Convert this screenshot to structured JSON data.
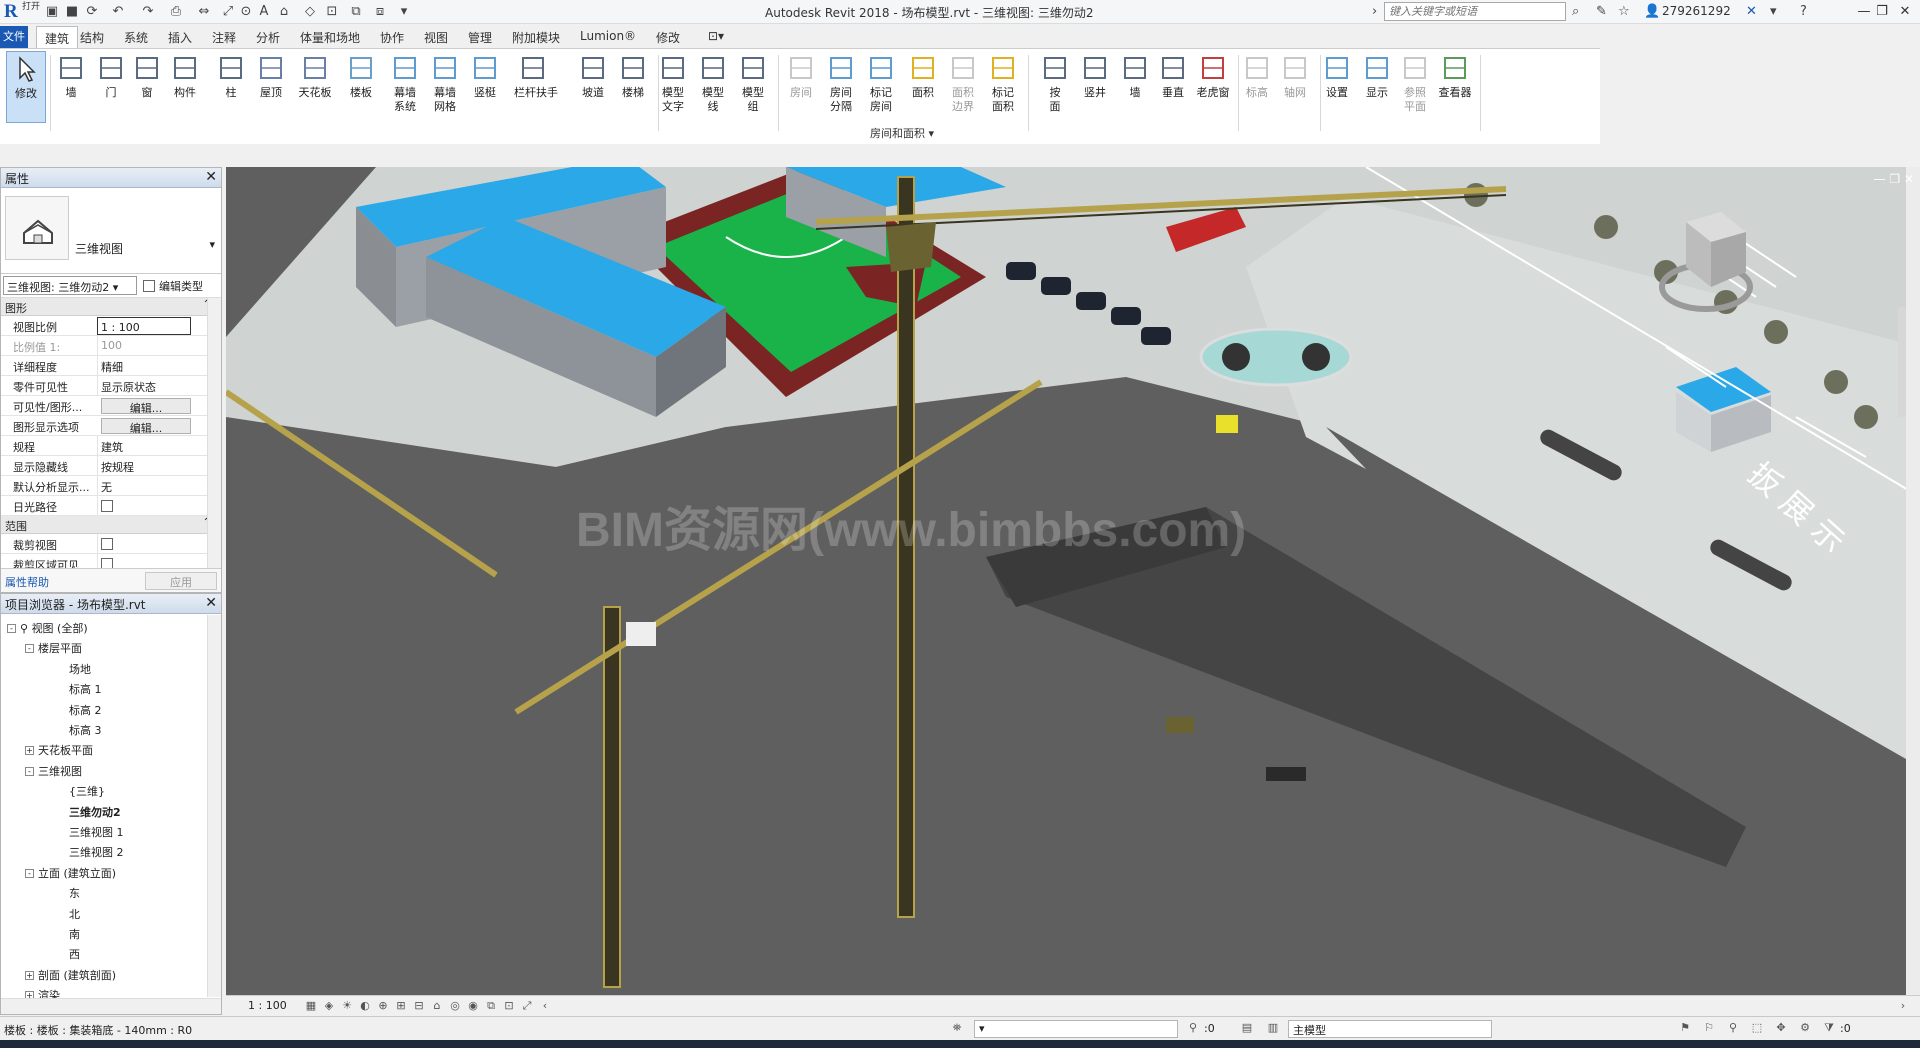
{
  "titlebar": {
    "app_sub": "打开",
    "title": "Autodesk Revit 2018 -    场布模型.rvt - 三维视图: 三维勿动2",
    "search_placeholder": "键入关键字或短语",
    "user": "279261292"
  },
  "ribbon_tabs": [
    "文件",
    "建筑",
    "结构",
    "系统",
    "插入",
    "注释",
    "分析",
    "体量和场地",
    "协作",
    "视图",
    "管理",
    "附加模块",
    "Lumion®",
    "修改"
  ],
  "ribbon": {
    "buttons": [
      {
        "label": "修改",
        "icon": "arrow-cursor-icon"
      },
      {
        "label": "墙",
        "icon": "wall-icon"
      },
      {
        "label": "门",
        "icon": "door-icon"
      },
      {
        "label": "窗",
        "icon": "window-icon"
      },
      {
        "label": "构件",
        "icon": "component-icon"
      },
      {
        "label": "柱",
        "icon": "column-icon"
      },
      {
        "label": "屋顶",
        "icon": "roof-icon"
      },
      {
        "label": "天花板",
        "icon": "ceiling-icon"
      },
      {
        "label": "楼板",
        "icon": "floor-icon"
      },
      {
        "label": "幕墙\n系统",
        "icon": "curtain-system-icon"
      },
      {
        "label": "幕墙\n网格",
        "icon": "curtain-grid-icon"
      },
      {
        "label": "竖梃",
        "icon": "mullion-icon"
      },
      {
        "label": "栏杆扶手",
        "icon": "railing-icon"
      },
      {
        "label": "坡道",
        "icon": "ramp-icon"
      },
      {
        "label": "楼梯",
        "icon": "stair-icon"
      },
      {
        "label": "模型\n文字",
        "icon": "model-text-icon"
      },
      {
        "label": "模型\n线",
        "icon": "model-line-icon"
      },
      {
        "label": "模型\n组",
        "icon": "model-group-icon"
      },
      {
        "label": "房间",
        "icon": "room-icon"
      },
      {
        "label": "房间\n分隔",
        "icon": "room-separator-icon"
      },
      {
        "label": "标记\n房间",
        "icon": "tag-room-icon"
      },
      {
        "label": "面积",
        "icon": "area-icon"
      },
      {
        "label": "面积\n边界",
        "icon": "area-boundary-icon"
      },
      {
        "label": "标记\n面积",
        "icon": "tag-area-icon"
      },
      {
        "label": "按\n面",
        "icon": "by-face-icon"
      },
      {
        "label": "竖井",
        "icon": "shaft-icon"
      },
      {
        "label": "墙",
        "icon": "wall-opening-icon"
      },
      {
        "label": "垂直",
        "icon": "vertical-opening-icon"
      },
      {
        "label": "老虎窗",
        "icon": "dormer-icon"
      },
      {
        "label": "标高",
        "icon": "level-icon"
      },
      {
        "label": "轴网",
        "icon": "grid-icon"
      },
      {
        "label": "设置",
        "icon": "workplane-set-icon"
      },
      {
        "label": "显示",
        "icon": "workplane-show-icon"
      },
      {
        "label": "参照\n平面",
        "icon": "ref-plane-icon"
      },
      {
        "label": "查看器",
        "icon": "viewer-icon"
      }
    ],
    "panel_label": "房间和面积 ▾"
  },
  "properties": {
    "title": "属性",
    "type_name": "三维视图",
    "view_selector": "三维视图: 三维勿动2",
    "edit_type": "编辑类型",
    "groups": [
      {
        "name": "图形",
        "rows": [
          {
            "k": "视图比例",
            "v": "1 : 100"
          },
          {
            "k": "比例值 1:",
            "v": "100"
          },
          {
            "k": "详细程度",
            "v": "精细"
          },
          {
            "k": "零件可见性",
            "v": "显示原状态"
          },
          {
            "k": "可见性/图形...",
            "v": "编辑..."
          },
          {
            "k": "图形显示选项",
            "v": "编辑..."
          },
          {
            "k": "规程",
            "v": "建筑"
          },
          {
            "k": "显示隐藏线",
            "v": "按规程"
          },
          {
            "k": "默认分析显示...",
            "v": "无"
          },
          {
            "k": "日光路径",
            "v": ""
          }
        ]
      },
      {
        "name": "范围",
        "rows": [
          {
            "k": "裁剪视图",
            "v": ""
          },
          {
            "k": "裁剪区域可见",
            "v": ""
          }
        ]
      }
    ],
    "help_link": "属性帮助",
    "apply": "应用"
  },
  "browser": {
    "title": "项目浏览器 - 场布模型.rvt",
    "items": [
      {
        "label": "视图 (全部)",
        "level": 0,
        "exp": "-"
      },
      {
        "label": "楼层平面",
        "level": 1,
        "exp": "-"
      },
      {
        "label": "场地",
        "level": 2
      },
      {
        "label": "标高 1",
        "level": 2
      },
      {
        "label": "标高 2",
        "level": 2
      },
      {
        "label": "标高 3",
        "level": 2
      },
      {
        "label": "天花板平面",
        "level": 1,
        "exp": "+"
      },
      {
        "label": "三维视图",
        "level": 1,
        "exp": "-"
      },
      {
        "label": "{三维}",
        "level": 2
      },
      {
        "label": "三维勿动2",
        "level": 2,
        "bold": true
      },
      {
        "label": "三维视图 1",
        "level": 2
      },
      {
        "label": "三维视图 2",
        "level": 2
      },
      {
        "label": "立面 (建筑立面)",
        "level": 1,
        "exp": "-"
      },
      {
        "label": "东",
        "level": 2
      },
      {
        "label": "北",
        "level": 2
      },
      {
        "label": "南",
        "level": 2
      },
      {
        "label": "西",
        "level": 2
      },
      {
        "label": "剖面 (建筑剖面)",
        "level": 1,
        "exp": "+"
      },
      {
        "label": "渲染",
        "level": 1,
        "exp": "+"
      }
    ]
  },
  "canvas": {
    "watermark": "BIM资源网(www.bimbbs.com)",
    "sign_text": "扳  展  示"
  },
  "viewbar": {
    "scale": "1 : 100"
  },
  "statusbar": {
    "text": "楼板 : 楼板 : 集装箱底 - 140mm : R0",
    "zero1": ":0",
    "model": "主模型",
    "zero2": ":0"
  },
  "colors": {
    "revit_blue": "#1a58b3",
    "roof_blue": "#2aa8e8",
    "court_green": "#19b34a",
    "court_red": "#7a2424",
    "crane_yellow": "#b5a24a",
    "ground_gray": "#5f5f5f"
  }
}
